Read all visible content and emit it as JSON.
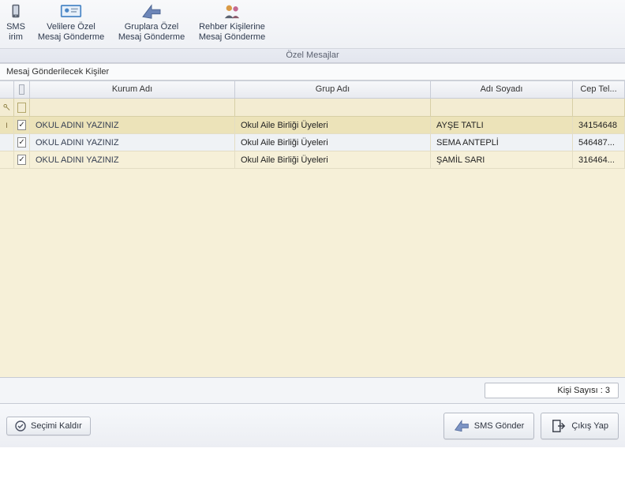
{
  "ribbon": {
    "group_label": "Özel Mesajlar",
    "buttons": [
      {
        "line1": "SMS",
        "line2": "irim"
      },
      {
        "line1": "Velilere Özel",
        "line2": "Mesaj Gönderme"
      },
      {
        "line1": "Gruplara Özel",
        "line2": "Mesaj Gönderme"
      },
      {
        "line1": "Rehber Kişilerine",
        "line2": "Mesaj Gönderme"
      }
    ]
  },
  "section_title": "Mesaj Gönderilecek Kişiler",
  "columns": {
    "kurum": "Kurum Adı",
    "grup": "Grup Adı",
    "ad": "Adı Soyadı",
    "cep": "Cep Tel..."
  },
  "rows": [
    {
      "kurum": "OKUL ADINI YAZINIZ",
      "grup": "Okul Aile Birliği Üyeleri",
      "ad": "AYŞE TATLI",
      "cep": "34154648",
      "checked": true,
      "selected": true
    },
    {
      "kurum": "OKUL ADINI YAZINIZ",
      "grup": "Okul Aile Birliği Üyeleri",
      "ad": "SEMA ANTEPLİ",
      "cep": "546487...",
      "checked": true,
      "selected": false
    },
    {
      "kurum": "OKUL ADINI YAZINIZ",
      "grup": "Okul Aile Birliği Üyeleri",
      "ad": "ŞAMİL SARI",
      "cep": "316464...",
      "checked": true,
      "selected": false
    }
  ],
  "footer": {
    "count_label": "Kişi Sayısı : 3"
  },
  "buttons": {
    "clear_selection": "Seçimi Kaldır",
    "send_sms": "SMS Gönder",
    "exit": "Çıkış Yap"
  }
}
